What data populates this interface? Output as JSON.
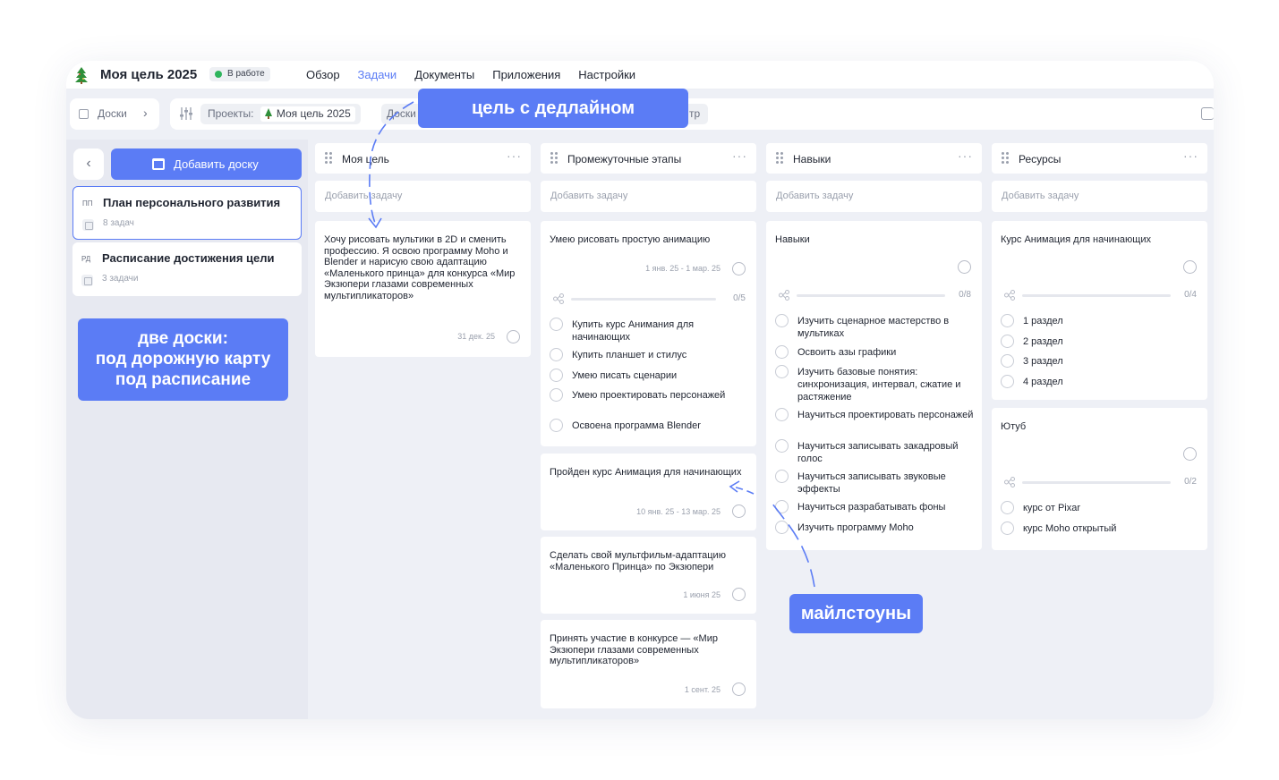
{
  "header": {
    "title": "Моя цель 2025",
    "status": "В работе",
    "nav": [
      "Обзор",
      "Задачи",
      "Документы",
      "Приложения",
      "Настройки"
    ]
  },
  "toolbar": {
    "boards_label": "Доски",
    "projects_label": "Проекты:",
    "project_value": "Моя цель 2025",
    "boards_filter": "Доски",
    "filter_tail": "тр"
  },
  "left": {
    "add_board": "Добавить доску",
    "boards": [
      {
        "abbr": "ПП",
        "name": "План персонального развития",
        "count": "8 задач"
      },
      {
        "abbr": "РД",
        "name": "Расписание достижения цели",
        "count": "3 задачи"
      }
    ]
  },
  "callouts": {
    "deadline_goal": "цель с дедлайном",
    "two_boards": "две доски:\nпод дорожную карту\nпод расписание",
    "milestones": "майлстоуны"
  },
  "add_task_label": "Добавить задачу",
  "columns": [
    {
      "title": "Моя цель",
      "cards": [
        {
          "title": "Хочу рисовать мультики в 2D и сменить профессию. Я освою программу Moho и Blender и нарисую свою адаптацию «Маленького принца» для конкурса «Мир Экзюпери глазами современных мультипликаторов»",
          "date": "31 дек. 25"
        }
      ]
    },
    {
      "title": "Промежуточные этапы",
      "cards": [
        {
          "title": "Умею рисовать простую анимацию",
          "date": "1 янв. 25 - 1 мар. 25",
          "progress": "0/5",
          "subtasks": [
            "Купить курс Анимания для начинающих",
            "Купить планшет и стилус",
            "Умею писать сценарии",
            "Умею проектировать персонажей",
            "Освоена программа Blender"
          ]
        },
        {
          "title": "Пройден курс Анимация для начинающих",
          "date": "10 янв. 25 - 13 мар. 25"
        },
        {
          "title": "Сделать свой мультфильм-адаптацию «Маленького Принца» по Экзюпери",
          "date": "1 июня 25"
        },
        {
          "title": "Принять участие в конкурсе — «Мир Экзюпери глазами современных мультипликаторов»",
          "date": "1 сент. 25"
        }
      ]
    },
    {
      "title": "Навыки",
      "cards": [
        {
          "title": "Навыки",
          "progress": "0/8",
          "subtasks": [
            "Изучить сценарное мастерство в мультиках",
            "Освоить азы графики",
            "Изучить базовые понятия: синхронизация, интервал, сжатие и растяжение",
            "Научиться проектировать персонажей",
            "Научиться записывать закадровый голос",
            "Научиться записывать звуковые эффекты",
            "Научиться разрабатывать фоны",
            "Изучить программу Moho"
          ]
        }
      ]
    },
    {
      "title": "Ресурсы",
      "cards": [
        {
          "title": "Курс Анимация для начинающих",
          "progress": "0/4",
          "subtasks": [
            "1 раздел",
            "2 раздел",
            "3 раздел",
            "4 раздел"
          ]
        },
        {
          "title": "Ютуб",
          "progress": "0/2",
          "subtasks": [
            "курс от Pixar",
            "курс Moho открытый"
          ]
        }
      ]
    }
  ],
  "colors": {
    "accent": "#5b7cf5",
    "status_green": "#2fb55d",
    "background": "#eef0f6"
  }
}
